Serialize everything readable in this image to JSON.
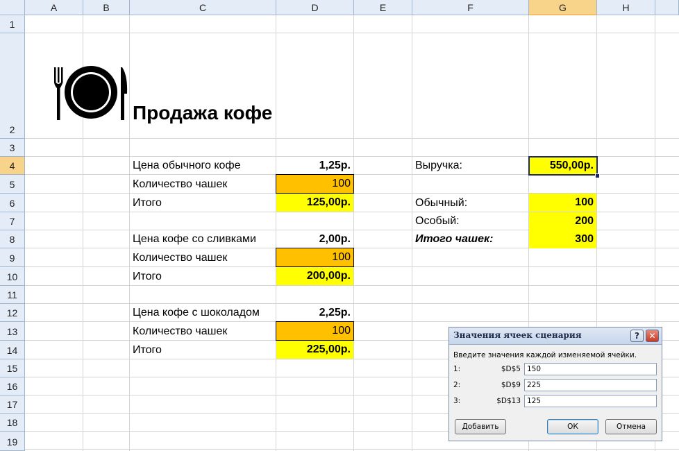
{
  "columns": [
    "A",
    "B",
    "C",
    "D",
    "E",
    "F",
    "G",
    "H"
  ],
  "active_column": "G",
  "rows": [
    "1",
    "2",
    "3",
    "4",
    "5",
    "6",
    "7",
    "8",
    "9",
    "10",
    "11",
    "12",
    "13",
    "14",
    "15",
    "16",
    "17",
    "18",
    "19"
  ],
  "active_row": "4",
  "title": "Продажа кофе",
  "logo_icon": "cutlery-plate-icon",
  "blocks": [
    {
      "price_label": "Цена обычного кофе",
      "price": "1,25р.",
      "qty_label": "Количество чашек",
      "qty": "100",
      "total_label": "Итого",
      "total": "125,00р."
    },
    {
      "price_label": "Цена кофе со сливками",
      "price": "2,00р.",
      "qty_label": "Количество чашек",
      "qty": "100",
      "total_label": "Итого",
      "total": "200,00р."
    },
    {
      "price_label": "Цена кофе с шоколадом",
      "price": "2,25р.",
      "qty_label": "Количество чашек",
      "qty": "100",
      "total_label": "Итого",
      "total": "225,00р."
    }
  ],
  "summary": {
    "revenue_label": "Выручка:",
    "revenue": "550,00р.",
    "regular_label": "Обычный:",
    "regular": "100",
    "special_label": "Особый:",
    "special": "200",
    "total_cups_label": "Итого чашек:",
    "total_cups": "300"
  },
  "colors": {
    "yellow": "#ffff00",
    "orange": "#ffc000",
    "header": "#e4ecf7",
    "active_header": "#f8d38a"
  },
  "dialog": {
    "title": "Значения ячеек сценария",
    "help_glyph": "?",
    "close_glyph": "✕",
    "prompt": "Введите значения каждой изменяемой ячейки.",
    "rows": [
      {
        "index": "1:",
        "ref": "$D$5",
        "value": "150"
      },
      {
        "index": "2:",
        "ref": "$D$9",
        "value": "225"
      },
      {
        "index": "3:",
        "ref": "$D$13",
        "value": "125"
      }
    ],
    "add_label": "Добавить",
    "ok_label": "ОК",
    "cancel_label": "Отмена"
  }
}
